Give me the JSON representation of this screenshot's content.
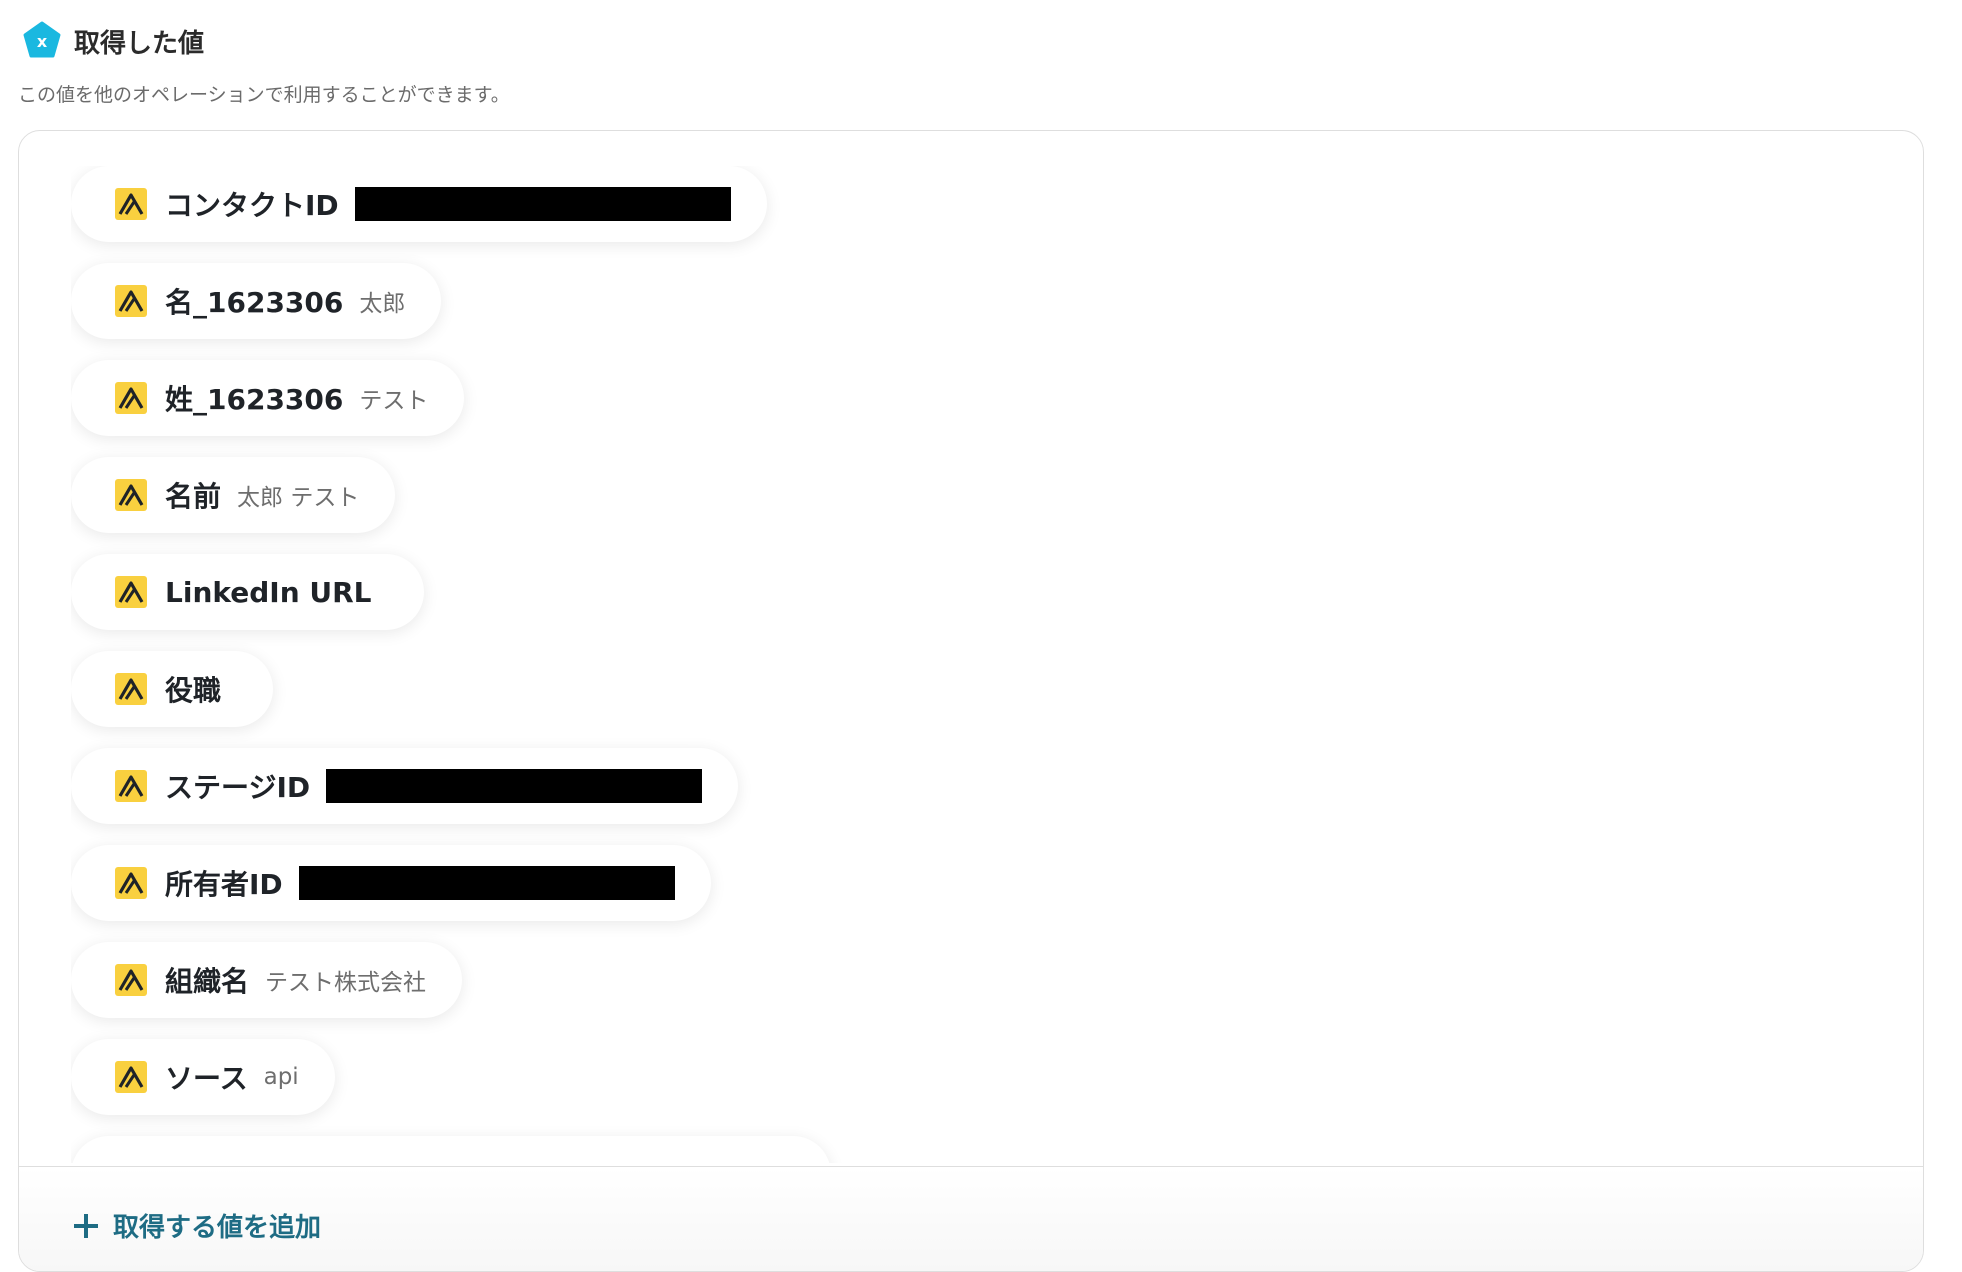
{
  "header": {
    "title": "取得した値",
    "icon": "variable-x-icon",
    "icon_color": "#1ab8e0"
  },
  "subtitle": "この値を他のオペレーションで利用することができます。",
  "items": [
    {
      "label": "コンタクトID",
      "value": "",
      "redacted": true
    },
    {
      "label": "名_1623306",
      "value": "太郎",
      "redacted": false
    },
    {
      "label": "姓_1623306",
      "value": "テスト",
      "redacted": false
    },
    {
      "label": "名前",
      "value": "太郎 テスト",
      "redacted": false
    },
    {
      "label": "LinkedIn URL",
      "value": "",
      "redacted": false
    },
    {
      "label": "役職",
      "value": "",
      "redacted": false
    },
    {
      "label": "ステージID",
      "value": "",
      "redacted": true
    },
    {
      "label": "所有者ID",
      "value": "",
      "redacted": true
    },
    {
      "label": "組織名",
      "value": "テスト株式会社",
      "redacted": false
    },
    {
      "label": "ソース",
      "value": "api",
      "redacted": false
    }
  ],
  "item_icon": "app-logo-icon",
  "item_icon_color": "#f9d03f",
  "footer": {
    "add_label": "取得する値を追加",
    "add_icon": "plus-icon",
    "accent_color": "#1e6c84"
  }
}
